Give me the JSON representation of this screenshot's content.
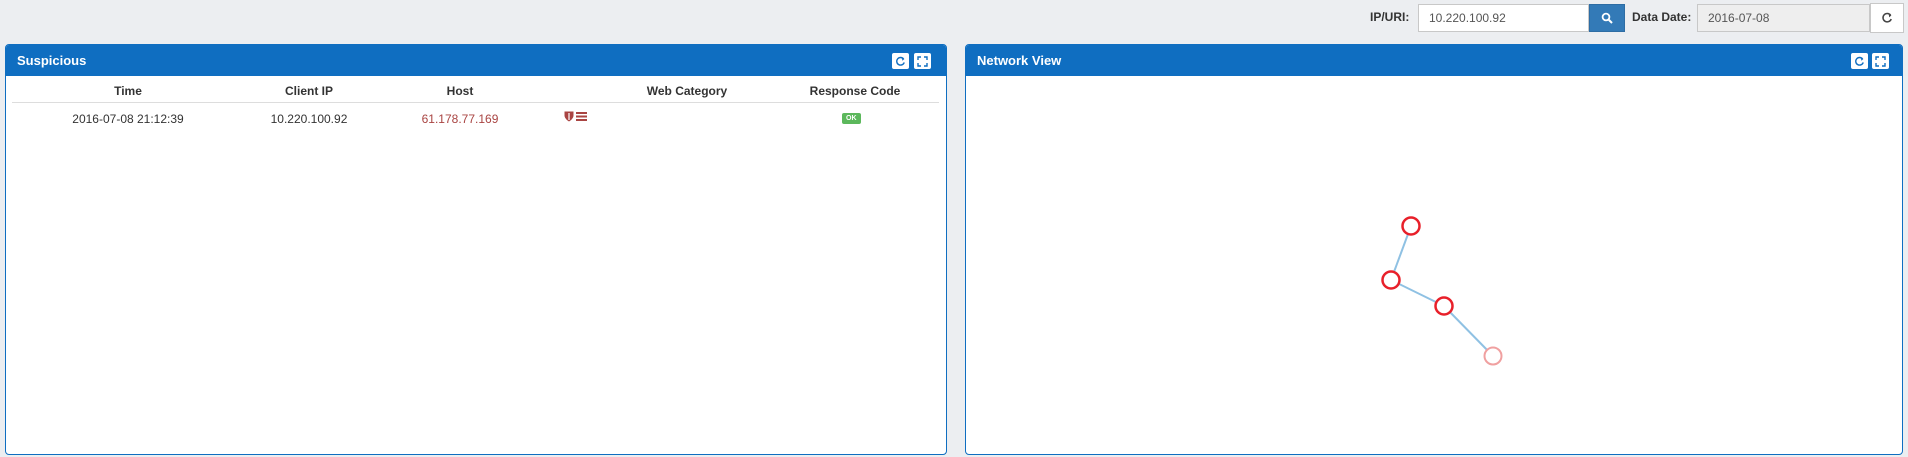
{
  "toolbar": {
    "ip_label": "IP/URI:",
    "ip_value": "10.220.100.92",
    "date_label": "Data Date:",
    "date_value": "2016-07-08",
    "search_icon": "search-icon",
    "refresh_icon": "refresh-icon"
  },
  "suspicious": {
    "title": "Suspicious",
    "columns": [
      "Time",
      "Client IP",
      "Host",
      "",
      "Web Category",
      "Response Code"
    ],
    "rows": [
      {
        "time": "2016-07-08 21:12:39",
        "client_ip": "10.220.100.92",
        "host": "61.178.77.169",
        "icons": [
          "shield-icon",
          "list-icon"
        ],
        "web_category": "",
        "response_code": "OK"
      }
    ]
  },
  "network": {
    "title": "Network View",
    "nodes": [
      {
        "id": "n1",
        "color": "#e8202a"
      },
      {
        "id": "n2",
        "color": "#e8202a"
      },
      {
        "id": "n3",
        "color": "#e8202a"
      },
      {
        "id": "n4",
        "color": "#f0a0a0"
      }
    ],
    "edges": [
      [
        "n1",
        "n2"
      ],
      [
        "n2",
        "n3"
      ],
      [
        "n3",
        "n4"
      ]
    ],
    "edge_color": "#8fc1e3"
  },
  "colors": {
    "panel_header": "#0f6ec1",
    "host_text": "#a94442",
    "badge_ok": "#5cb85c",
    "search_button": "#337ab7"
  }
}
